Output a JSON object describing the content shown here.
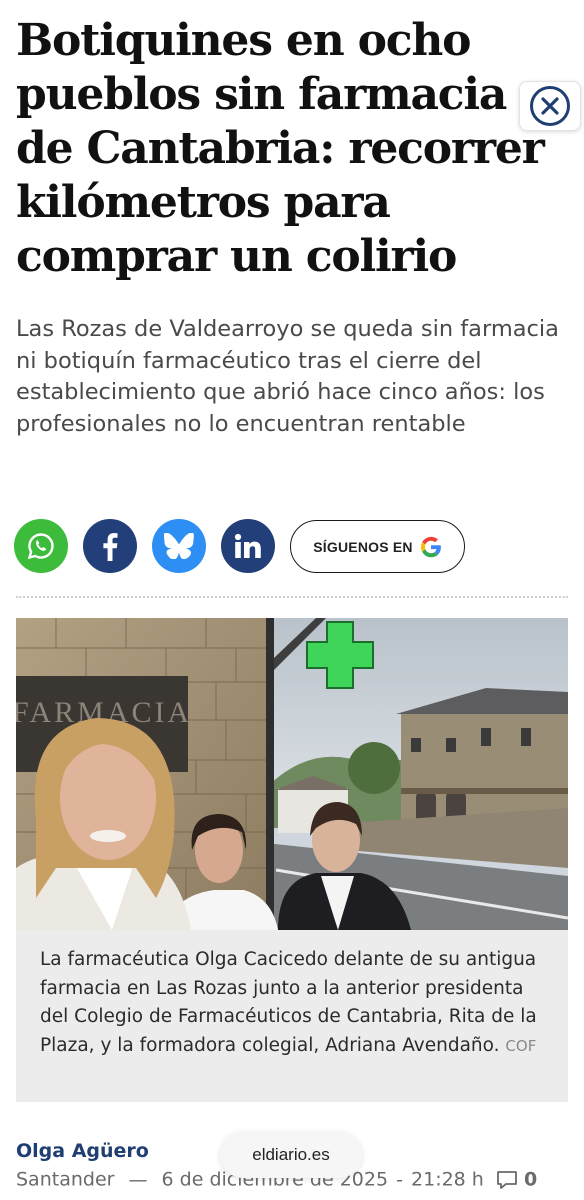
{
  "article": {
    "headline": "Botiquines en ocho pueblos sin farmacia de Cantabria: recorrer kilómetros para comprar un colirio",
    "lead": "Las Rozas de Valdearroyo se queda sin farmacia ni botiquín farmacéutico tras el cierre del establecimiento que abrió hace cinco años: los profesionales no lo encuentran rentable"
  },
  "share": {
    "icons": [
      "whatsapp-icon",
      "facebook-icon",
      "bluesky-icon",
      "linkedin-icon"
    ],
    "colors": {
      "whatsapp": "#3dbb3a",
      "facebook": "#223f7a",
      "bluesky": "#2d8ff3",
      "linkedin": "#223f7a"
    },
    "follow_label": "SÍGUENOS EN"
  },
  "photo": {
    "sign_text": "FARMACIA",
    "caption": "La farmacéutica Olga Cacicedo delante de su antigua farmacia en Las Rozas junto a la anterior presidenta del Colegio de Farmacéuticos de Cantabria, Rita de la Plaza, y la formadora colegial, Adriana Avendaño.",
    "credit": "COF"
  },
  "byline": {
    "author": "Olga Agüero",
    "location": "Santander",
    "separator": "—",
    "date": "6 de diciembre de 2025",
    "time": "21:28 h",
    "comments": "0"
  },
  "site_pill": "eldiario.es",
  "colors": {
    "brand_navy": "#1f3f73",
    "caption_bg": "#ececec"
  }
}
